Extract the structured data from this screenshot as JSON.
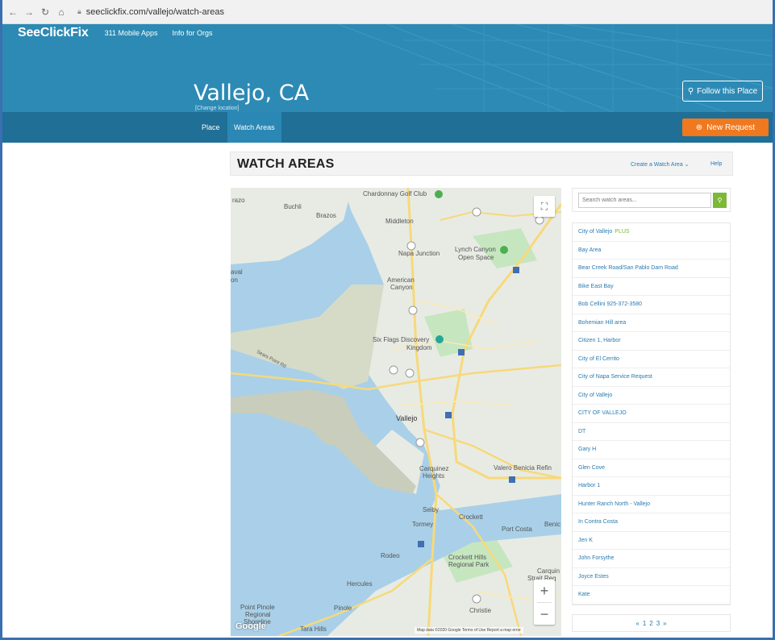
{
  "browser": {
    "url": "seeclickfix.com/vallejo/watch-areas"
  },
  "header": {
    "logo": "SeeClickFix",
    "nav": [
      "311 Mobile Apps",
      "Info for Orgs"
    ],
    "place_title": "Vallejo, CA",
    "change_location": "[Change location]",
    "follow_label": "Follow this Place"
  },
  "subnav": {
    "tabs": [
      {
        "label": "Place",
        "active": false
      },
      {
        "label": "Watch Areas",
        "active": true
      }
    ],
    "new_request_label": "New Request"
  },
  "section": {
    "title": "WATCH AREAS",
    "create_label": "Create a Watch Area",
    "help_label": "Help"
  },
  "search": {
    "placeholder": "Search watch areas..."
  },
  "watch_areas": [
    {
      "name": "City of Vallejo",
      "plus": "PLUS"
    },
    {
      "name": "Bay Area"
    },
    {
      "name": "Bear Creek Road/San Pablo Dam Road"
    },
    {
      "name": "Bike East Bay"
    },
    {
      "name": "Bob Cellini 925-372-3580"
    },
    {
      "name": "Bohemian Hill area"
    },
    {
      "name": "Citizen 1, Harbor"
    },
    {
      "name": "City of El Cerrito"
    },
    {
      "name": "City of Napa Service Request"
    },
    {
      "name": "City of Vallejo"
    },
    {
      "name": "CITY OF VALLEJO"
    },
    {
      "name": "DT"
    },
    {
      "name": "Gary H"
    },
    {
      "name": "Glen Cove"
    },
    {
      "name": "Harbor 1"
    },
    {
      "name": "Hunter Ranch North - Vallejo"
    },
    {
      "name": "In Contra Costa"
    },
    {
      "name": "Jen K"
    },
    {
      "name": "John Forsythe"
    },
    {
      "name": "Joyce Estes"
    },
    {
      "name": "Kate"
    }
  ],
  "pagination": {
    "prev": "«",
    "pages": [
      "1",
      "2",
      "3"
    ],
    "next": "»"
  },
  "map": {
    "labels": {
      "chardonnay": "Chardonnay Golf Club",
      "buchli": "Buchli",
      "brazos": "Brazos",
      "middleton": "Middleton",
      "napa_junction": "Napa Junction",
      "lynch": "Lynch Canyon",
      "open_space": "Open Space",
      "american": "American",
      "canyon": "Canyon",
      "six_flags": "Six Flags Discovery",
      "kingdom": "Kingdom",
      "vallejo": "Vallejo",
      "carquinez": "Carquinez",
      "heights": "Heights",
      "valero": "Valero Benicia Refin",
      "selby": "Selby",
      "tormey": "Tormey",
      "crockett": "Crockett",
      "port_costa": "Port Costa",
      "benicia": "Benic",
      "rodeo": "Rodeo",
      "crockett_hills": "Crockett Hills",
      "regional_park": "Regional Park",
      "carquinez_strait": "Carquin",
      "strait_reg": "Strait Reg",
      "hercules": "Hercules",
      "pinole": "Pinole",
      "christie": "Christie",
      "point_pinole": "Point Pinole",
      "regional": "Regional",
      "shoreline": "Shoreline",
      "tara_hills": "Tara Hills",
      "razo": "razo",
      "naval": "aval",
      "on": "on",
      "sears_point": "Sears Point Rd"
    },
    "google": "Google",
    "credits": "Map data ©2020 Google   Terms of Use   Report a map error",
    "colors": {
      "water": "#a9d0e8",
      "land": "#e8ebe4",
      "park": "#c6e6c0",
      "road": "#f7d97a",
      "marsh": "#d6dbc7"
    }
  }
}
